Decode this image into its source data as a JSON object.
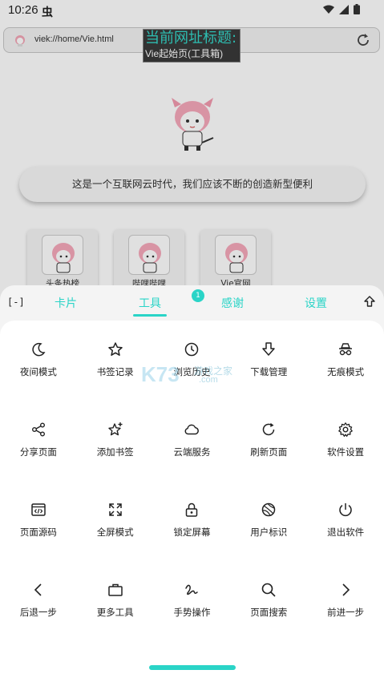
{
  "status_bar": {
    "time": "10:26",
    "notification_icon": "虫"
  },
  "browser": {
    "url": "viek://home/Vie.html",
    "title_tooltip": {
      "heading": "当前网址标题:",
      "value": "Vie起始页(工具箱)"
    },
    "slogan": "这是一个互联网云时代，我们应该不断的创造新型便利",
    "shortcuts": [
      {
        "label": "头条热榜"
      },
      {
        "label": "哔哩哔哩"
      },
      {
        "label": "Vie官网"
      }
    ]
  },
  "sheet": {
    "collapse_label": "[-]",
    "tabs": [
      {
        "label": "卡片",
        "active": false
      },
      {
        "label": "工具",
        "active": true
      },
      {
        "label": "感谢",
        "active": false
      },
      {
        "label": "设置",
        "active": false
      }
    ],
    "badge": "1",
    "tools": [
      {
        "label": "夜间模式",
        "icon": "moon-icon"
      },
      {
        "label": "书签记录",
        "icon": "star-icon"
      },
      {
        "label": "浏览历史",
        "icon": "clock-icon"
      },
      {
        "label": "下载管理",
        "icon": "download-icon"
      },
      {
        "label": "无痕模式",
        "icon": "incognito-icon"
      },
      {
        "label": "分享页面",
        "icon": "share-icon"
      },
      {
        "label": "添加书签",
        "icon": "star-add-icon"
      },
      {
        "label": "云端服务",
        "icon": "cloud-icon"
      },
      {
        "label": "刷新页面",
        "icon": "refresh-icon"
      },
      {
        "label": "软件设置",
        "icon": "gear-icon"
      },
      {
        "label": "页面源码",
        "icon": "code-icon"
      },
      {
        "label": "全屏模式",
        "icon": "fullscreen-icon"
      },
      {
        "label": "锁定屏幕",
        "icon": "lock-icon"
      },
      {
        "label": "用户标识",
        "icon": "globe-icon"
      },
      {
        "label": "退出软件",
        "icon": "power-icon"
      },
      {
        "label": "后退一步",
        "icon": "chevron-left-icon"
      },
      {
        "label": "更多工具",
        "icon": "briefcase-icon"
      },
      {
        "label": "手势操作",
        "icon": "gesture-icon"
      },
      {
        "label": "页面搜索",
        "icon": "search-icon"
      },
      {
        "label": "前进一步",
        "icon": "chevron-right-icon"
      }
    ]
  },
  "watermark": {
    "logo": "K73",
    "text": "游戏之家",
    "domain": ".com"
  },
  "colors": {
    "accent": "#2ad4c7",
    "tooltip_bg": "#3a3a3a"
  }
}
